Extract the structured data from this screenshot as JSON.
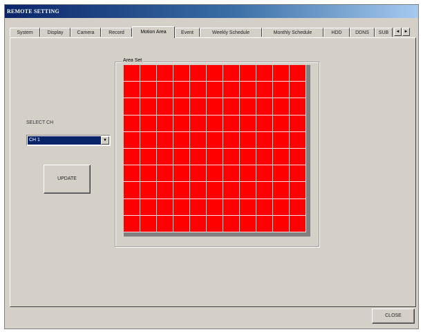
{
  "window": {
    "title": "REMOTE SETTING"
  },
  "tabs": [
    {
      "label": "System"
    },
    {
      "label": "Display"
    },
    {
      "label": "Camera"
    },
    {
      "label": "Record"
    },
    {
      "label": "Motion Area",
      "active": true
    },
    {
      "label": "Event"
    },
    {
      "label": "Weekly Schedule"
    },
    {
      "label": "Monthly Schedule"
    },
    {
      "label": "HDD"
    },
    {
      "label": "DDNS"
    },
    {
      "label": "SUB"
    }
  ],
  "tab_scroll": {
    "left_icon": "arrow-left-icon",
    "right_icon": "arrow-right-icon",
    "left_glyph": "◄",
    "right_glyph": "►"
  },
  "area_set": {
    "label": "Area Set",
    "grid_columns": 11,
    "grid_rows": 10,
    "cell_color": "#ff0000",
    "all_selected": true
  },
  "channel": {
    "label": "SELECT CH",
    "value": "CH 1",
    "dropdown_glyph": "▼"
  },
  "buttons": {
    "update": "UPDATE",
    "close": "CLOSE"
  },
  "colors": {
    "dialog_bg": "#d4d0c8",
    "titlebar": "#0a246a",
    "grid_selected": "#ff0000"
  }
}
